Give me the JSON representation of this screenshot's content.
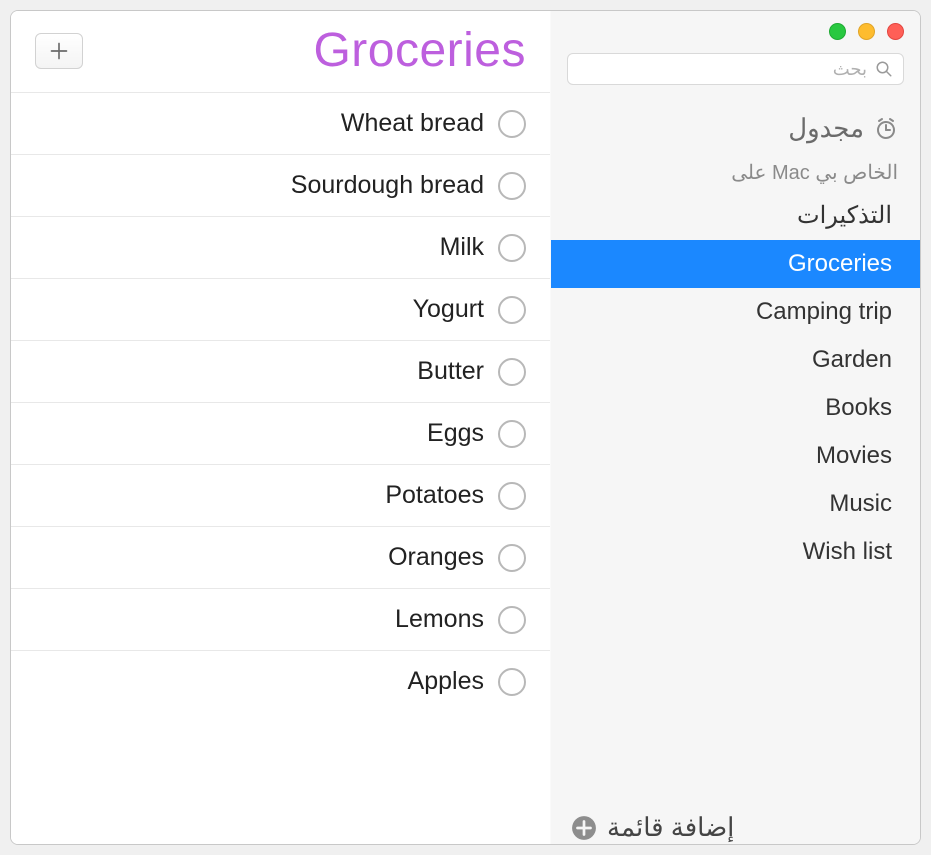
{
  "search": {
    "placeholder": "بحث"
  },
  "scheduled": {
    "label": "مجدول"
  },
  "account": {
    "label": "الخاص بي Mac على"
  },
  "sidebar": {
    "items": [
      {
        "label": "التذكيرات",
        "selected": false,
        "ar": true
      },
      {
        "label": "Groceries",
        "selected": true,
        "ar": false
      },
      {
        "label": "Camping trip",
        "selected": false,
        "ar": false
      },
      {
        "label": "Garden",
        "selected": false,
        "ar": false
      },
      {
        "label": "Books",
        "selected": false,
        "ar": false
      },
      {
        "label": "Movies",
        "selected": false,
        "ar": false
      },
      {
        "label": "Music",
        "selected": false,
        "ar": false
      },
      {
        "label": "Wish list",
        "selected": false,
        "ar": false
      }
    ]
  },
  "add_list": {
    "label": "إضافة قائمة"
  },
  "content": {
    "title": "Groceries",
    "items": [
      {
        "text": "Wheat bread"
      },
      {
        "text": "Sourdough bread"
      },
      {
        "text": "Milk"
      },
      {
        "text": "Yogurt"
      },
      {
        "text": "Butter"
      },
      {
        "text": "Eggs"
      },
      {
        "text": "Potatoes"
      },
      {
        "text": "Oranges"
      },
      {
        "text": "Lemons"
      },
      {
        "text": "Apples"
      }
    ]
  }
}
